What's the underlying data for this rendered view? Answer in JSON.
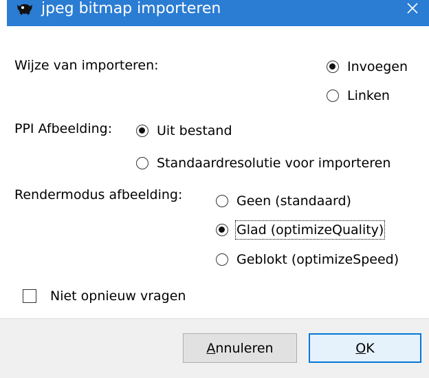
{
  "window": {
    "title": "jpeg bitmap importeren",
    "app_icon": "inkscape-icon",
    "close_icon": "close-icon"
  },
  "import_mode": {
    "label": "Wijze van importeren:",
    "options": [
      {
        "label": "Invoegen",
        "checked": true
      },
      {
        "label": "Linken",
        "checked": false
      }
    ]
  },
  "ppi": {
    "label": "PPI Afbeelding:",
    "options": [
      {
        "label": "Uit bestand",
        "checked": true
      },
      {
        "label": "Standaardresolutie voor importeren",
        "checked": false
      }
    ]
  },
  "render_mode": {
    "label": "Rendermodus afbeelding:",
    "options": [
      {
        "label": "Geen (standaard)",
        "checked": false
      },
      {
        "label": "Glad (optimizeQuality)",
        "checked": true
      },
      {
        "label": "Geblokt (optimizeSpeed)",
        "checked": false
      }
    ]
  },
  "dont_ask": {
    "label": "Niet opnieuw vragen",
    "checked": false
  },
  "buttons": {
    "cancel": {
      "mnemonic": "A",
      "rest": "nnuleren"
    },
    "ok": {
      "mnemonic": "O",
      "rest": "K"
    }
  }
}
